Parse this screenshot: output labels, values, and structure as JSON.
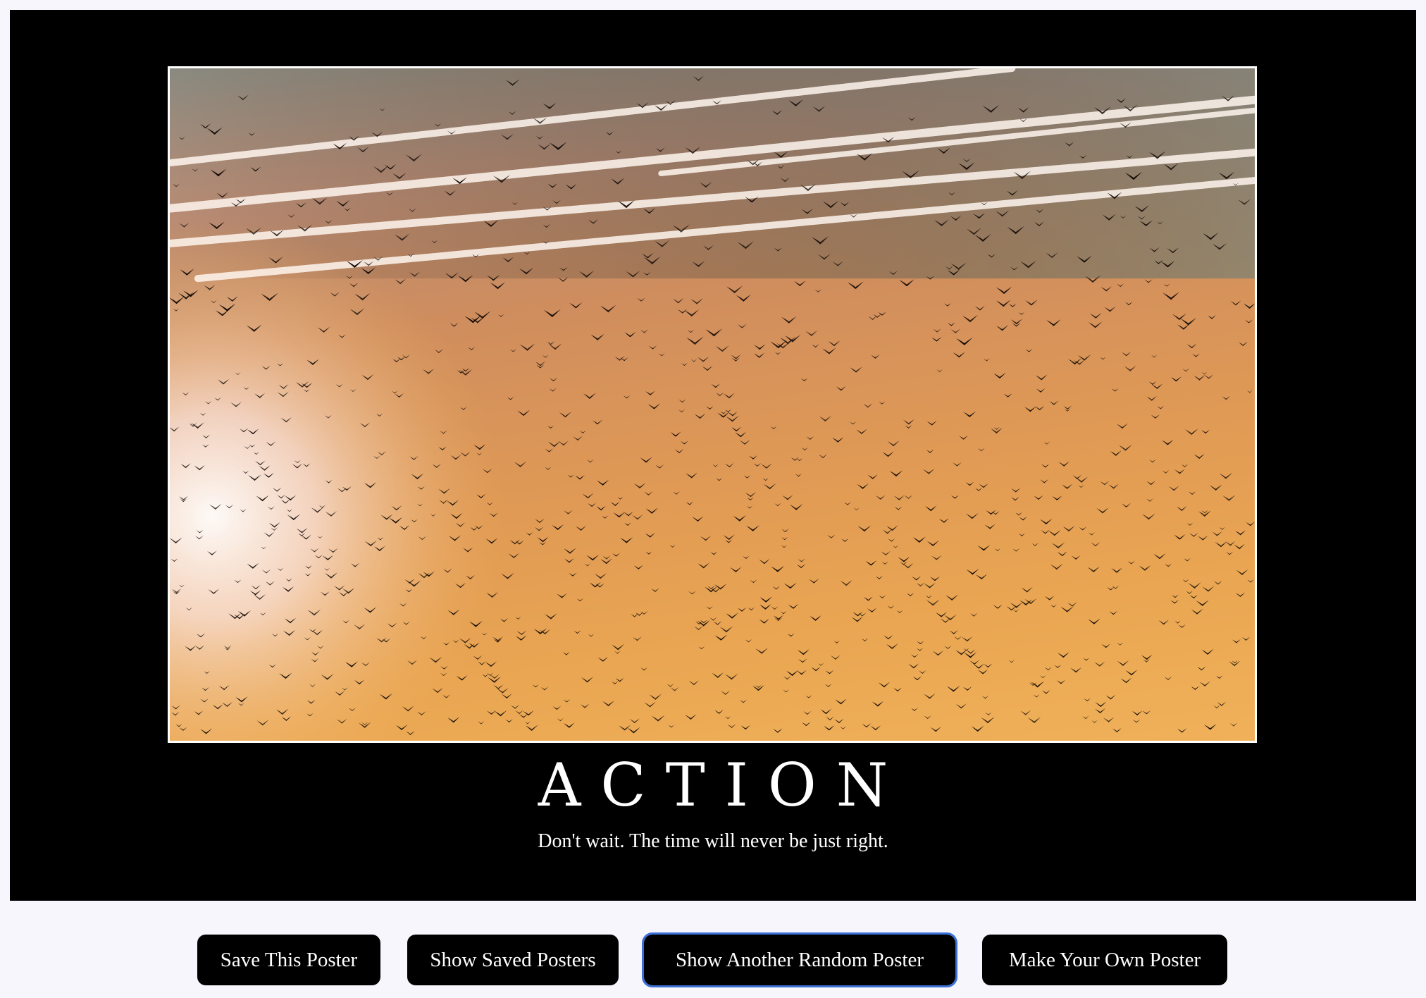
{
  "poster": {
    "image_alt": "flock of birds flying in an orange sunset sky with contrails",
    "title": "ACTION",
    "quote": "Don't wait. The time will never be just right."
  },
  "controls": {
    "save_label": "Save This Poster",
    "show_saved_label": "Show Saved Posters",
    "random_label": "Show Another Random Poster",
    "make_own_label": "Make Your Own Poster"
  },
  "colors": {
    "page_background": "#f7f6fd",
    "poster_background": "#000000",
    "button_background": "#000000",
    "button_text": "#ffffff",
    "focus_outline": "#3a6fd8"
  }
}
